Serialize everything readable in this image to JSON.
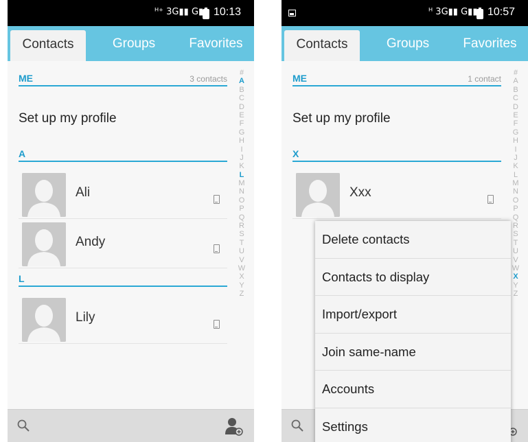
{
  "screens": [
    {
      "status": {
        "network": "3G",
        "time": "10:13"
      },
      "tabs": [
        "Contacts",
        "Groups",
        "Favorites"
      ],
      "me_section": {
        "label": "ME",
        "count": "3 contacts"
      },
      "profile_text": "Set up my profile",
      "groups": [
        {
          "letter": "A",
          "contacts": [
            "Ali",
            "Andy"
          ]
        },
        {
          "letter": "L",
          "contacts": [
            "Lily"
          ]
        }
      ],
      "alphabet": [
        "#",
        "A",
        "B",
        "C",
        "D",
        "E",
        "F",
        "G",
        "H",
        "I",
        "J",
        "K",
        "L",
        "M",
        "N",
        "O",
        "P",
        "Q",
        "R",
        "S",
        "T",
        "U",
        "V",
        "W",
        "X",
        "Y",
        "Z"
      ],
      "highlighted_letters": [
        "A",
        "L"
      ]
    },
    {
      "status": {
        "network": "3G",
        "time": "10:57"
      },
      "tabs": [
        "Contacts",
        "Groups",
        "Favorites"
      ],
      "me_section": {
        "label": "ME",
        "count": "1 contact"
      },
      "profile_text": "Set up my profile",
      "groups": [
        {
          "letter": "X",
          "contacts": [
            "Xxx"
          ]
        }
      ],
      "alphabet": [
        "#",
        "A",
        "B",
        "C",
        "D",
        "E",
        "F",
        "G",
        "H",
        "I",
        "J",
        "K",
        "L",
        "M",
        "N",
        "O",
        "P",
        "Q",
        "R",
        "S",
        "T",
        "U",
        "V",
        "W",
        "X",
        "Y",
        "Z"
      ],
      "highlighted_letters": [
        "X"
      ],
      "menu": [
        "Delete contacts",
        "Contacts to display",
        "Import/export",
        "Join same-name",
        "Accounts",
        "Settings"
      ]
    }
  ],
  "colors": {
    "accent": "#1e9ccc",
    "tab_bar": "#66c5e1",
    "avatar": "#c9c9c9"
  },
  "icons": {
    "bottom_left": "search-icon",
    "bottom_right": "add-contact-icon",
    "row_type": "phone-icon"
  }
}
